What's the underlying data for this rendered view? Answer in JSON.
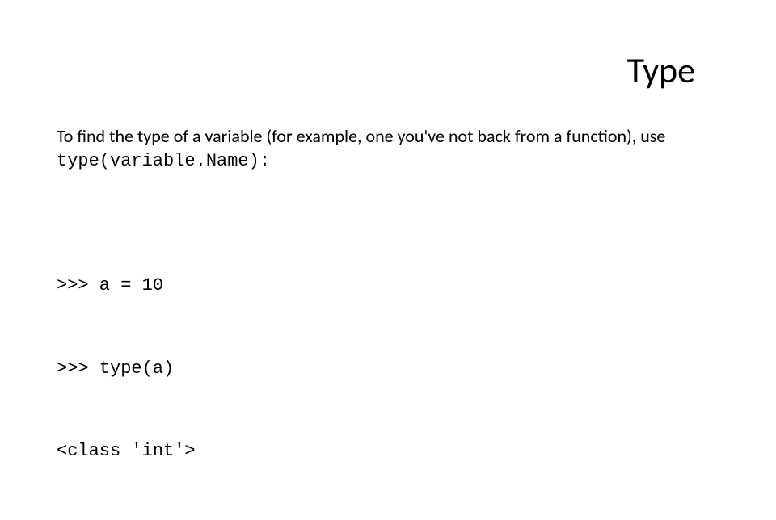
{
  "title": "Type",
  "description_part1": "To find the type of a variable (for example, one you've not back from a function), use ",
  "description_code": "type(variable.Name):",
  "code_line1": ">>> a = 10",
  "code_line2": ">>> type(a)",
  "code_line3": "<class 'int'>"
}
